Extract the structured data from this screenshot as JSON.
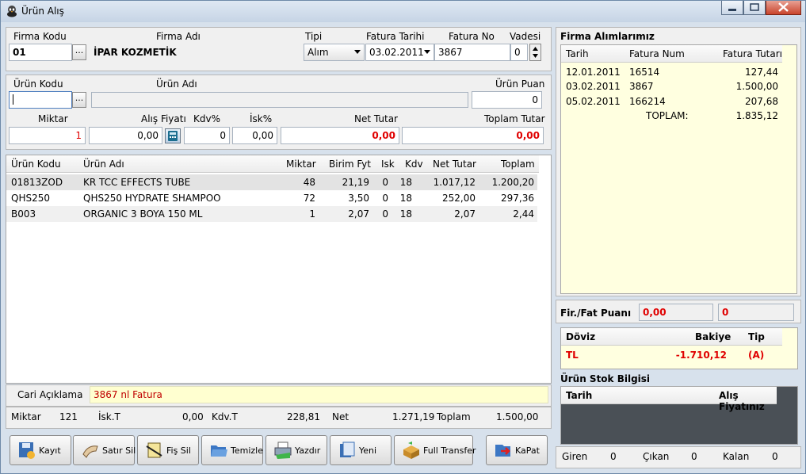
{
  "window": {
    "title": "Ürün Alış"
  },
  "header": {
    "firma_kodu_label": "Firma Kodu",
    "firma_adi_label": "Firma Adı",
    "tipi_label": "Tipi",
    "fatura_tarihi_label": "Fatura Tarihi",
    "fatura_no_label": "Fatura No",
    "vadesi_label": "Vadesi",
    "firma_kodu": "01",
    "firma_adi": "İPAR KOZMETİK",
    "tipi": "Alım",
    "fatura_tarihi": "03.02.2011",
    "fatura_no": "3867",
    "vadesi": "0",
    "browse": "..."
  },
  "product": {
    "urun_kodu_label": "Ürün Kodu",
    "urun_adi_label": "Ürün Adı",
    "urun_puan_label": "Ürün Puan",
    "urun_puan": "0",
    "miktar_label": "Miktar",
    "alis_fiyati_label": "Alış Fiyatı",
    "kdv_label": "Kdv%",
    "isk_label": "İsk%",
    "net_tutar_label": "Net Tutar",
    "toplam_tutar_label": "Toplam Tutar",
    "miktar": "1",
    "alis_fiyati": "0,00",
    "kdv": "0",
    "isk": "0,00",
    "net_tutar": "0,00",
    "toplam_tutar": "0,00"
  },
  "items": {
    "headers": [
      "Ürün Kodu",
      "Ürün Adı",
      "Miktar",
      "Birim Fyt",
      "Isk",
      "Kdv",
      "Net Tutar",
      "Toplam"
    ],
    "rows": [
      [
        "01813ZOD",
        "KR TCC EFFECTS TUBE",
        "48",
        "21,19",
        "0",
        "18",
        "1.017,12",
        "1.200,20"
      ],
      [
        "QHS250",
        "QHS250 HYDRATE SHAMPOO",
        "72",
        "3,50",
        "0",
        "18",
        "252,00",
        "297,36"
      ],
      [
        "B003",
        "ORGANIC 3 BOYA 150 ML",
        "1",
        "2,07",
        "0",
        "18",
        "2,07",
        "2,44"
      ]
    ]
  },
  "cari": {
    "label": "Cari Açıklama",
    "value": "3867 nl Fatura"
  },
  "totals": {
    "miktar_label": "Miktar",
    "miktar": "121",
    "iskt_label": "İsk.T",
    "iskt": "0,00",
    "kdvt_label": "Kdv.T",
    "kdvt": "228,81",
    "net_label": "Net",
    "net": "1.271,19",
    "toplam_label": "Toplam",
    "toplam": "1.500,00"
  },
  "buttons": {
    "kayit": "Kayıt",
    "satir_sil": "Satır Sil",
    "fis_sil": "Fiş Sil",
    "temizle": "Temizle",
    "yazdir": "Yazdır",
    "yeni": "Yeni",
    "full_transfer": "Full Transfer",
    "kapat": "KaPat"
  },
  "firma_alimlari": {
    "title": "Firma Alımlarımız",
    "headers": [
      "Tarih",
      "Fatura Num",
      "Fatura Tutarı"
    ],
    "rows": [
      [
        "12.01.2011",
        "16514",
        "127,44"
      ],
      [
        "03.02.2011",
        "3867",
        "1.500,00"
      ],
      [
        "05.02.2011",
        "166214",
        "207,68"
      ]
    ],
    "toplam_label": "TOPLAM:",
    "toplam": "1.835,12"
  },
  "puan": {
    "label": "Fir./Fat Puanı",
    "fir": "0,00",
    "fat": "0"
  },
  "doviz": {
    "headers": [
      "Döviz",
      "Bakiye",
      "Tip"
    ],
    "row": [
      "TL",
      "-1.710,12",
      "(A)"
    ]
  },
  "stok": {
    "title": "Ürün Stok Bilgisi",
    "headers": [
      "Tarih",
      "Alış Fiyatınız"
    ],
    "giren_label": "Giren",
    "giren": "0",
    "cikan_label": "Çıkan",
    "cikan": "0",
    "kalan_label": "Kalan",
    "kalan": "0"
  },
  "colors": {
    "accent_red": "#e00000",
    "highlight_yellow": "#ffffe0"
  }
}
